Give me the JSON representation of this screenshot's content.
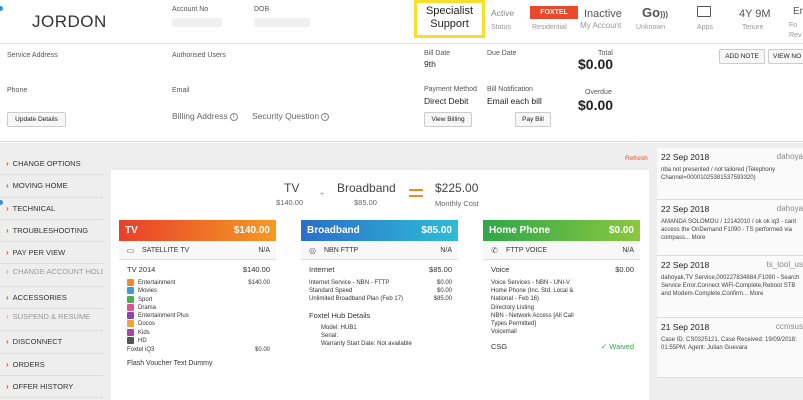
{
  "header": {
    "name": "JORDON",
    "account_no_label": "Account No",
    "dob_label": "DOB",
    "specialist_badge": "Specialist Support",
    "active_label": "Active",
    "status_label": "Status",
    "foxtel_badge": "FOXTEL",
    "residential_label": "Residential",
    "inactive_label": "Inactive",
    "my_account_label": "My Account",
    "go_label": "Go",
    "unknown_label": "Unknown",
    "apps_label": "Apps",
    "tenure_value": "4Y 9M",
    "tenure_label": "Tenure",
    "fo_label": "Fo",
    "rev_label": "Rev",
    "er_label": "Er"
  },
  "details": {
    "service_address_label": "Service Address",
    "authorised_users_label": "Authorised Users",
    "phone_label": "Phone",
    "email_label": "Email",
    "update_details_button": "Update Details",
    "billing_address_label": "Billing Address",
    "security_question_label": "Security Question",
    "bill_date_label": "Bill Date",
    "bill_date_value": "9th",
    "due_date_label": "Due Date",
    "total_label": "Total",
    "total_value": "$0.00",
    "payment_method_label": "Payment Method",
    "payment_method_value": "Direct Debit",
    "bill_notification_label": "Bill Notification",
    "bill_notification_value": "Email each bill",
    "overdue_label": "Overdue",
    "overdue_value": "$0.00",
    "view_billing_button": "View Billing",
    "pay_bill_button": "Pay Bill",
    "add_note_button": "ADD NOTE",
    "view_notes_button": "VIEW NO"
  },
  "nav": {
    "items": [
      {
        "label": "CHANGE OPTIONS",
        "dim": false
      },
      {
        "label": "MOVING HOME",
        "dim": false
      },
      {
        "label": "TECHNICAL",
        "dim": false
      },
      {
        "label": "TROUBLESHOOTING",
        "dim": false
      },
      {
        "label": "PAY PER VIEW",
        "dim": false
      },
      {
        "label": "CHANGE ACCOUNT HOLDER",
        "dim": true
      },
      {
        "label": "ACCESSORIES",
        "dim": false
      },
      {
        "label": "SUSPEND & RESUME",
        "dim": true
      },
      {
        "label": "DISCONNECT",
        "dim": false
      },
      {
        "label": "ORDERS",
        "dim": false
      },
      {
        "label": "OFFER HISTORY",
        "dim": false
      }
    ]
  },
  "summary": {
    "refresh_label": "Refresh",
    "tv_label": "TV",
    "tv_price": "$140.00",
    "plus": "+",
    "broadband_label": "Broadband",
    "broadband_price": "$85.00",
    "total_price": "$225.00",
    "monthly_cost_label": "Monthly Cost"
  },
  "tv": {
    "title": "TV",
    "price": "$140.00",
    "service": "SATELLITE TV",
    "service_status": "N/A",
    "package": "TV 2014",
    "package_price": "$140.00",
    "items": [
      {
        "label": "Entertainment",
        "price": "$140.00",
        "color": "#f08a24"
      },
      {
        "label": "Movies",
        "price": "",
        "color": "#3b9ad9"
      },
      {
        "label": "Sport",
        "price": "",
        "color": "#4caf50"
      },
      {
        "label": "Drama",
        "price": "",
        "color": "#e05299"
      },
      {
        "label": "Entertainment Plus",
        "price": "",
        "color": "#8e44ad"
      },
      {
        "label": "Docos",
        "price": "",
        "color": "#f3a53b"
      },
      {
        "label": "Kids",
        "price": "",
        "color": "#b03ea8"
      },
      {
        "label": "HD",
        "price": "",
        "color": "#555555"
      }
    ],
    "extra": "Foxtel iQ3",
    "extra_price": "$0.00",
    "voucher": "Flash Voucher Text  Dummy"
  },
  "broadband": {
    "title": "Broadband",
    "price": "$85.00",
    "service": "NBN FTTP",
    "service_status": "N/A",
    "package": "Internet",
    "package_price": "$85.00",
    "lines": [
      {
        "label": "Internet Service - NBN - FTTP",
        "price": "$0.00"
      },
      {
        "label": "Standard Speed",
        "price": "$0.00"
      },
      {
        "label": "Unlimited Broadband Plan (Feb 17)",
        "price": "$85.00"
      }
    ],
    "hub_title": "Foxtel Hub Details",
    "hub_model": "Model: HUB1",
    "hub_serial": "Serial:",
    "hub_warranty": "Warranty Start Date: Not available"
  },
  "phone": {
    "title": "Home Phone",
    "price": "$0.00",
    "service": "FTTP VOICE",
    "service_status": "N/A",
    "package": "Voice",
    "package_price": "$0.00",
    "lines": [
      "Voice Services - NBN - UNI-V",
      "Home Phone (Inc. Std. Local &",
      "National - Feb 16)",
      "Directory Listing",
      "NBN - Network Access [All Call",
      "Types Permitted]",
      "Voicemail"
    ],
    "csg_label": "CSG",
    "csg_status": "Waived"
  },
  "notes": [
    {
      "date": "22 Sep 2018",
      "user": "dahoya",
      "text": "nba not presented / not tailored (Telephony Channel=00001025381537593320)"
    },
    {
      "date": "22 Sep 2018",
      "user": "dahoya",
      "text": "AMANDA SOLOMOU / 12142010 / ok ok iq3 - cant access the OnDemand F1090 - TS performed via compass... More"
    },
    {
      "date": "22 Sep 2018",
      "user": "ts_tool_us",
      "text": "dahoyak,TV Service,000227834884,F1090 - Search Service Error.Connect WiFi-Complete,Reboot STB and Modem-Complete,Confirm... More"
    },
    {
      "date": "21 Sep 2018",
      "user": "ccmsus",
      "text": "Case ID: CS0325121, Case Received: 19/09/2018: 01:55PM, Agent: Julian Guevara"
    }
  ]
}
